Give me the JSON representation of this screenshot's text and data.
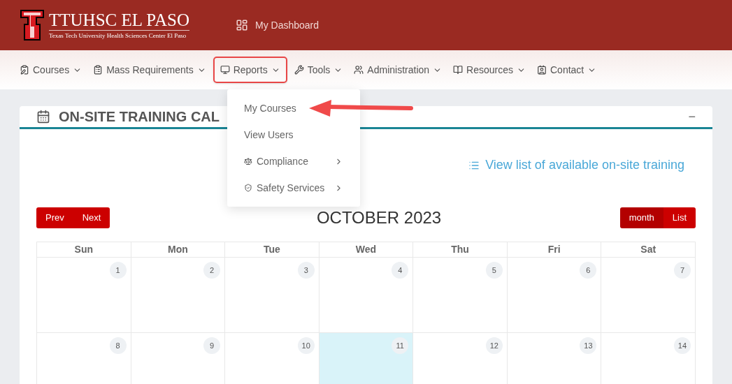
{
  "header": {
    "brand": "TTUHSC EL PASO",
    "subtitle": "Texas Tech University Health Sciences Center El Paso",
    "dashboard_link": "My Dashboard"
  },
  "nav": [
    {
      "label": "Courses",
      "highlighted": false
    },
    {
      "label": "Mass Requirements",
      "highlighted": false
    },
    {
      "label": "Reports",
      "highlighted": true
    },
    {
      "label": "Tools",
      "highlighted": false
    },
    {
      "label": "Administration",
      "highlighted": false
    },
    {
      "label": "Resources",
      "highlighted": false
    },
    {
      "label": "Contact",
      "highlighted": false
    }
  ],
  "dropdown": [
    {
      "label": "My Courses",
      "kind": "link",
      "pointed": true
    },
    {
      "label": "View Users",
      "kind": "link",
      "pointed": false
    },
    {
      "label": "Compliance",
      "kind": "submenu",
      "pointed": false
    },
    {
      "label": "Safety Services",
      "kind": "submenu",
      "pointed": false
    }
  ],
  "card": {
    "title": "ON-SITE TRAINING CAL",
    "collapse": "−",
    "list_link": "View list of available on-site training"
  },
  "calendar": {
    "month": "OCTOBER 2023",
    "nav_buttons": [
      "Prev",
      "Next"
    ],
    "views": [
      {
        "label": "month",
        "selected": true
      },
      {
        "label": "List",
        "selected": false
      }
    ],
    "weekdays": [
      "Sun",
      "Mon",
      "Tue",
      "Wed",
      "Thu",
      "Fri",
      "Sat"
    ],
    "weeks": [
      [
        {
          "day": "1",
          "today": false
        },
        {
          "day": "2",
          "today": false
        },
        {
          "day": "3",
          "today": false
        },
        {
          "day": "4",
          "today": false
        },
        {
          "day": "5",
          "today": false
        },
        {
          "day": "6",
          "today": false
        },
        {
          "day": "7",
          "today": false
        }
      ],
      [
        {
          "day": "8",
          "today": false
        },
        {
          "day": "9",
          "today": false
        },
        {
          "day": "10",
          "today": false
        },
        {
          "day": "11",
          "today": true
        },
        {
          "day": "12",
          "today": false
        },
        {
          "day": "13",
          "today": false
        },
        {
          "day": "14",
          "today": false
        }
      ]
    ]
  }
}
